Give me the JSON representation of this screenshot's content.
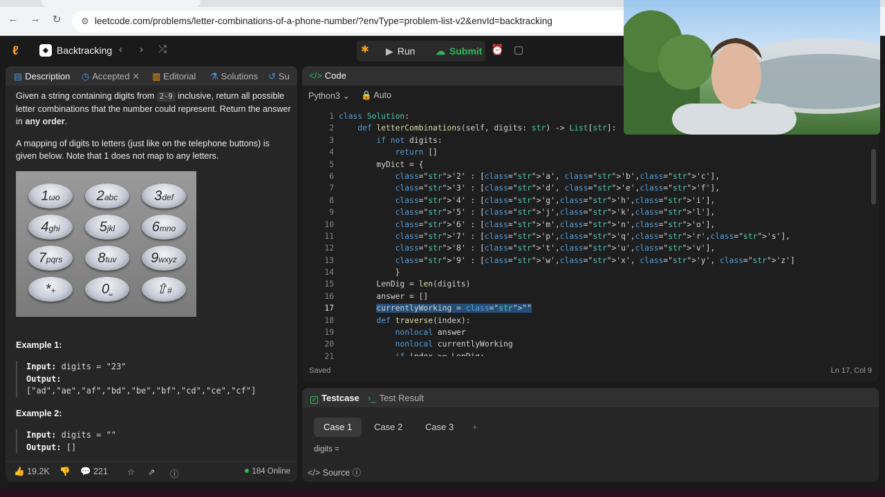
{
  "browser": {
    "url": "leetcode.com/problems/letter-combinations-of-a-phone-number/?envType=problem-list-v2&envId=backtracking"
  },
  "header": {
    "list_title": "Backtracking",
    "run_label": "Run",
    "submit_label": "Submit"
  },
  "left_tabs": [
    {
      "label": "Description"
    },
    {
      "label": "Accepted"
    },
    {
      "label": "Editorial"
    },
    {
      "label": "Solutions"
    },
    {
      "label": "Su"
    }
  ],
  "description": {
    "p1_a": "Given a string containing digits from ",
    "p1_code": "2-9",
    "p1_b": " inclusive, return all possible letter combinations that the number could represent. Return the answer in ",
    "p1_bold": "any order",
    "p1_c": ".",
    "p2": "A mapping of digits to letters (just like on the telephone buttons) is given below. Note that 1 does not map to any letters."
  },
  "keypad": [
    {
      "digit": "1",
      "letters": "ωο"
    },
    {
      "digit": "2",
      "letters": "abc"
    },
    {
      "digit": "3",
      "letters": "def"
    },
    {
      "digit": "4",
      "letters": "ghi"
    },
    {
      "digit": "5",
      "letters": "jkl"
    },
    {
      "digit": "6",
      "letters": "mno"
    },
    {
      "digit": "7",
      "letters": "pqrs"
    },
    {
      "digit": "8",
      "letters": "tuv"
    },
    {
      "digit": "9",
      "letters": "wxyz"
    },
    {
      "digit": "*",
      "letters": "+"
    },
    {
      "digit": "0",
      "letters": "⎵"
    },
    {
      "digit": "⇧",
      "letters": "#"
    }
  ],
  "examples": [
    {
      "title": "Example 1:",
      "input_label": "Input:",
      "input": "digits = \"23\"",
      "output_label": "Output:",
      "output": "[\"ad\",\"ae\",\"af\",\"bd\",\"be\",\"bf\",\"cd\",\"ce\",\"cf\"]"
    },
    {
      "title": "Example 2:",
      "input_label": "Input:",
      "input": "digits = \"\"",
      "output_label": "Output:",
      "output": "[]"
    }
  ],
  "left_footer": {
    "likes": "19.2K",
    "comments": "221",
    "online": "184 Online"
  },
  "code_panel": {
    "title": "Code",
    "language": "Python3",
    "autocomplete": "Auto",
    "saved": "Saved",
    "cursor": "Ln 17, Col 9",
    "current_line": 17
  },
  "code_lines": [
    "class Solution:",
    "    def letterCombinations(self, digits: str) -> List[str]:",
    "        if not digits:",
    "            return []",
    "        myDict = {",
    "            '2' : ['a', 'b','c'],",
    "            '3' : ['d', 'e','f'],",
    "            '4' : ['g','h','i'],",
    "            '5' : ['j','k','l'],",
    "            '6' : ['m','n','o'],",
    "            '7' : ['p','q','r','s'],",
    "            '8' : ['t','u','v'],",
    "            '9' : ['w','x', 'y', 'z']",
    "            }",
    "        LenDig = len(digits)",
    "        answer = []",
    "        currentlyWorking = \"\"",
    "        def traverse(index):",
    "            nonlocal answer",
    "            nonlocal currentlyWorking",
    "            if index >= LenDig:"
  ],
  "test_panel": {
    "tab_testcase": "Testcase",
    "tab_result": "Test Result",
    "cases": [
      "Case 1",
      "Case 2",
      "Case 3"
    ],
    "digits_label": "digits =",
    "source_label": "Source"
  },
  "colors": {
    "accent_orange": "#ffa116",
    "accent_green": "#2cbb5d"
  }
}
